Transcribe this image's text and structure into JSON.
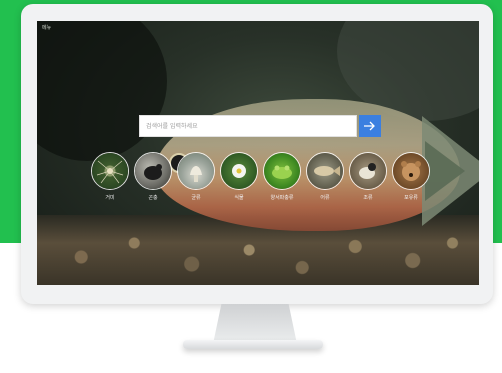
{
  "screen": {
    "corner_label": "메뉴"
  },
  "search": {
    "placeholder": "검색어를 입력하세요",
    "value": "",
    "button_icon": "arrow-right-icon",
    "button_color": "#3b7fe0"
  },
  "categories": [
    {
      "label": "거미",
      "icon": "spider-icon"
    },
    {
      "label": "곤충",
      "icon": "insect-icon"
    },
    {
      "label": "균류",
      "icon": "fungus-icon"
    },
    {
      "label": "식물",
      "icon": "flower-icon"
    },
    {
      "label": "양서파충류",
      "icon": "frog-icon"
    },
    {
      "label": "어류",
      "icon": "fish-icon"
    },
    {
      "label": "조류",
      "icon": "bird-icon"
    },
    {
      "label": "포유류",
      "icon": "mammal-icon"
    }
  ],
  "colors": {
    "brand_green": "#22c04f",
    "search_button": "#3b7fe0"
  }
}
